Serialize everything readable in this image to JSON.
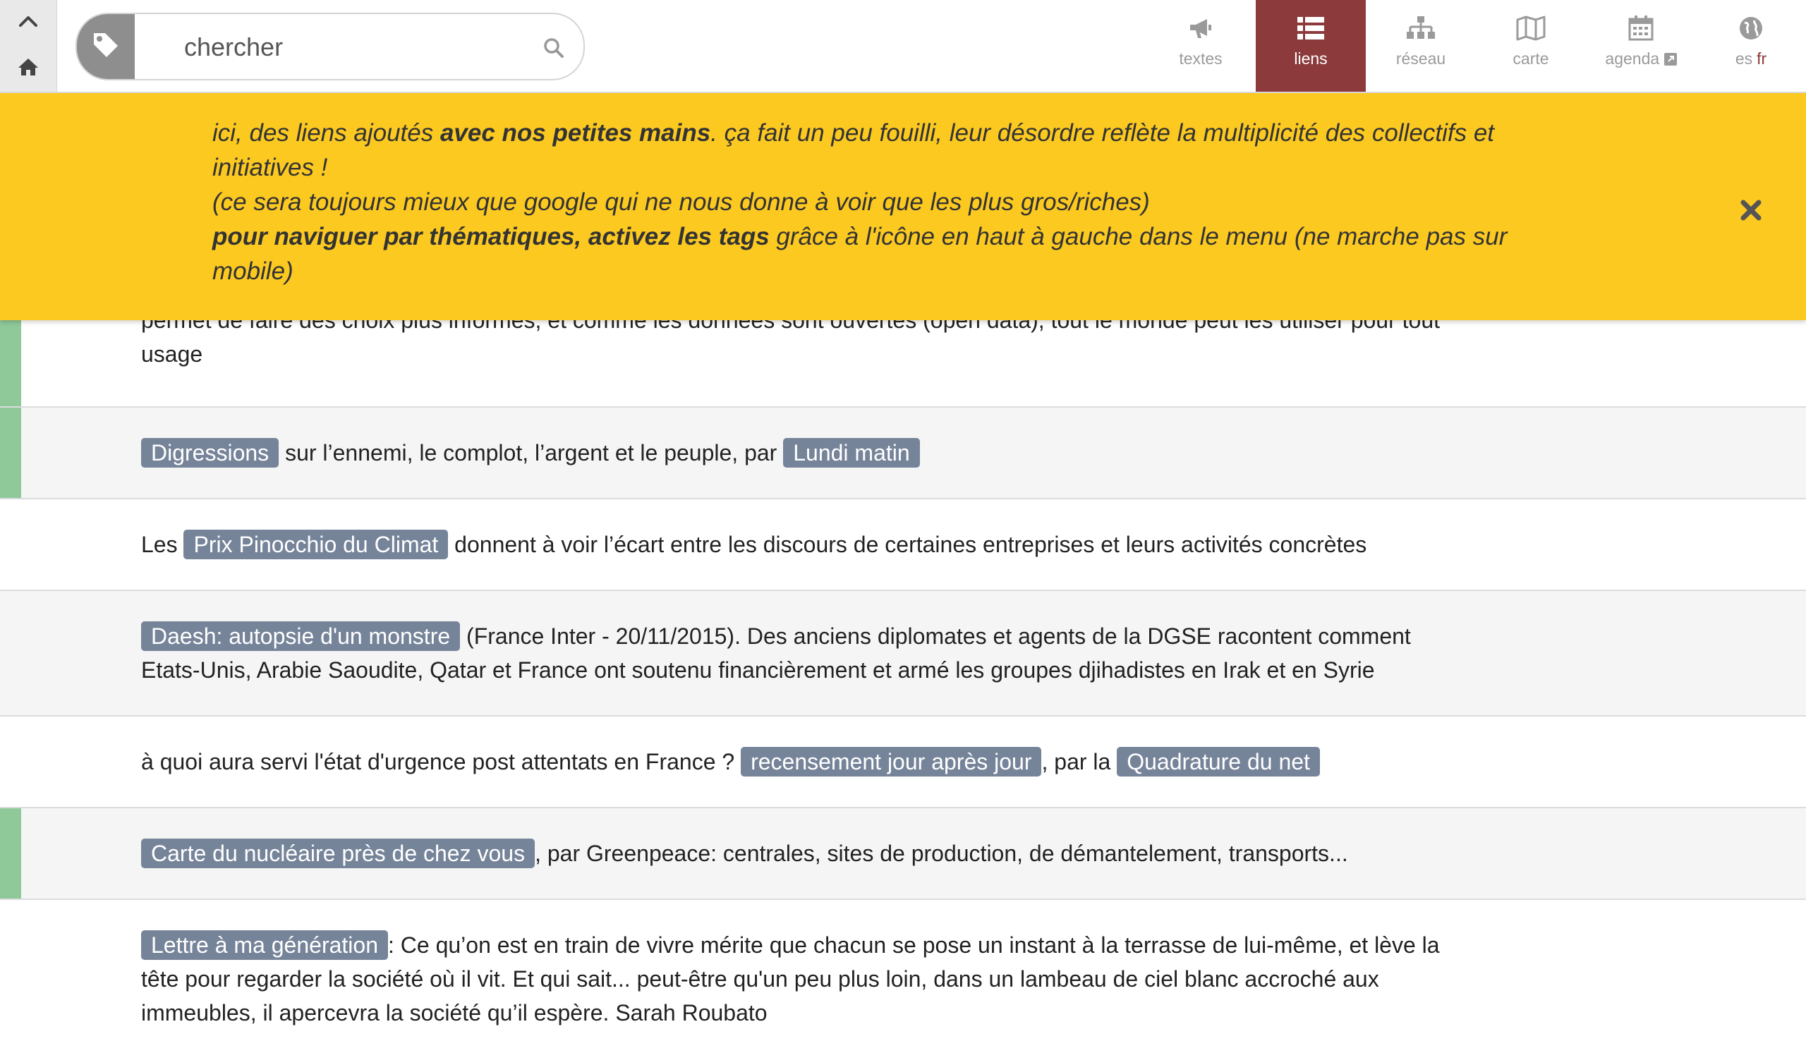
{
  "search": {
    "placeholder": "chercher"
  },
  "nav": {
    "textes": "textes",
    "liens": "liens",
    "reseau": "réseau",
    "carte": "carte",
    "agenda": "agenda",
    "lang_es": "es",
    "lang_fr": "fr"
  },
  "colors": {
    "active": "#8c3a3b",
    "banner": "#fcc921",
    "tag": "#76849a",
    "flag": "#8fc99a"
  },
  "icons": [
    "arrow-up-icon",
    "home-icon",
    "tag-icon",
    "search-icon",
    "megaphone-icon",
    "list-icon",
    "sitemap-icon",
    "map-icon",
    "calendar-icon",
    "external-link-icon",
    "globe-icon",
    "close-icon"
  ],
  "banner": {
    "l1_a": "ici, des liens ajoutés ",
    "l1_b": "avec nos petites mains",
    "l1_c": ". ça fait un peu fouilli, leur désordre reflète la multiplicité des collectifs et initiatives !",
    "l2": "(ce sera toujours mieux que google qui ne nous donne à voir que les plus gros/riches)",
    "l3_a": "pour naviguer par thématiques, activez les tags",
    "l3_b": " grâce à l'icône en haut à gauche dans le menu (ne marche pas sur mobile)"
  },
  "rows": [
    {
      "text": "permet de faire des choix plus informés, et comme les données sont ouvertes (open data), tout le monde peut les utiliser pour tout usage"
    },
    {
      "tag1": "Digressions",
      "text": " sur l’ennemi, le complot, l’argent et le peuple, par ",
      "tag2": "Lundi matin"
    },
    {
      "pre": "Les ",
      "tag1": "Prix Pinocchio du Climat",
      "text": " donnent à voir l’écart entre les discours de certaines entreprises et leurs activités concrètes"
    },
    {
      "tag1": "Daesh: autopsie d'un monstre",
      "text": " (France Inter - 20/11/2015). Des anciens diplomates et agents de la DGSE racontent comment Etats-Unis, Arabie Saoudite, Qatar et France ont soutenu financièrement et armé les groupes djihadistes en Irak et en Syrie"
    },
    {
      "pre": "à quoi aura servi l'état d'urgence post attentats en France ? ",
      "tag1": "recensement jour après jour",
      "text": ", par la ",
      "tag2": "Quadrature du net"
    },
    {
      "tag1": "Carte du nucléaire près de chez vous",
      "text": ", par Greenpeace: centrales, sites de production, de démantelement, transports..."
    },
    {
      "tag1": "Lettre à ma génération",
      "text": ": Ce qu’on est en train de vivre mérite que chacun se pose un instant à la terrasse de lui-même, et lève la tête pour regarder la société où il vit. Et qui sait... peut-être qu'un peu plus loin, dans un lambeau de ciel blanc accroché aux immeubles, il apercevra la société qu’il espère. Sarah Roubato"
    }
  ]
}
